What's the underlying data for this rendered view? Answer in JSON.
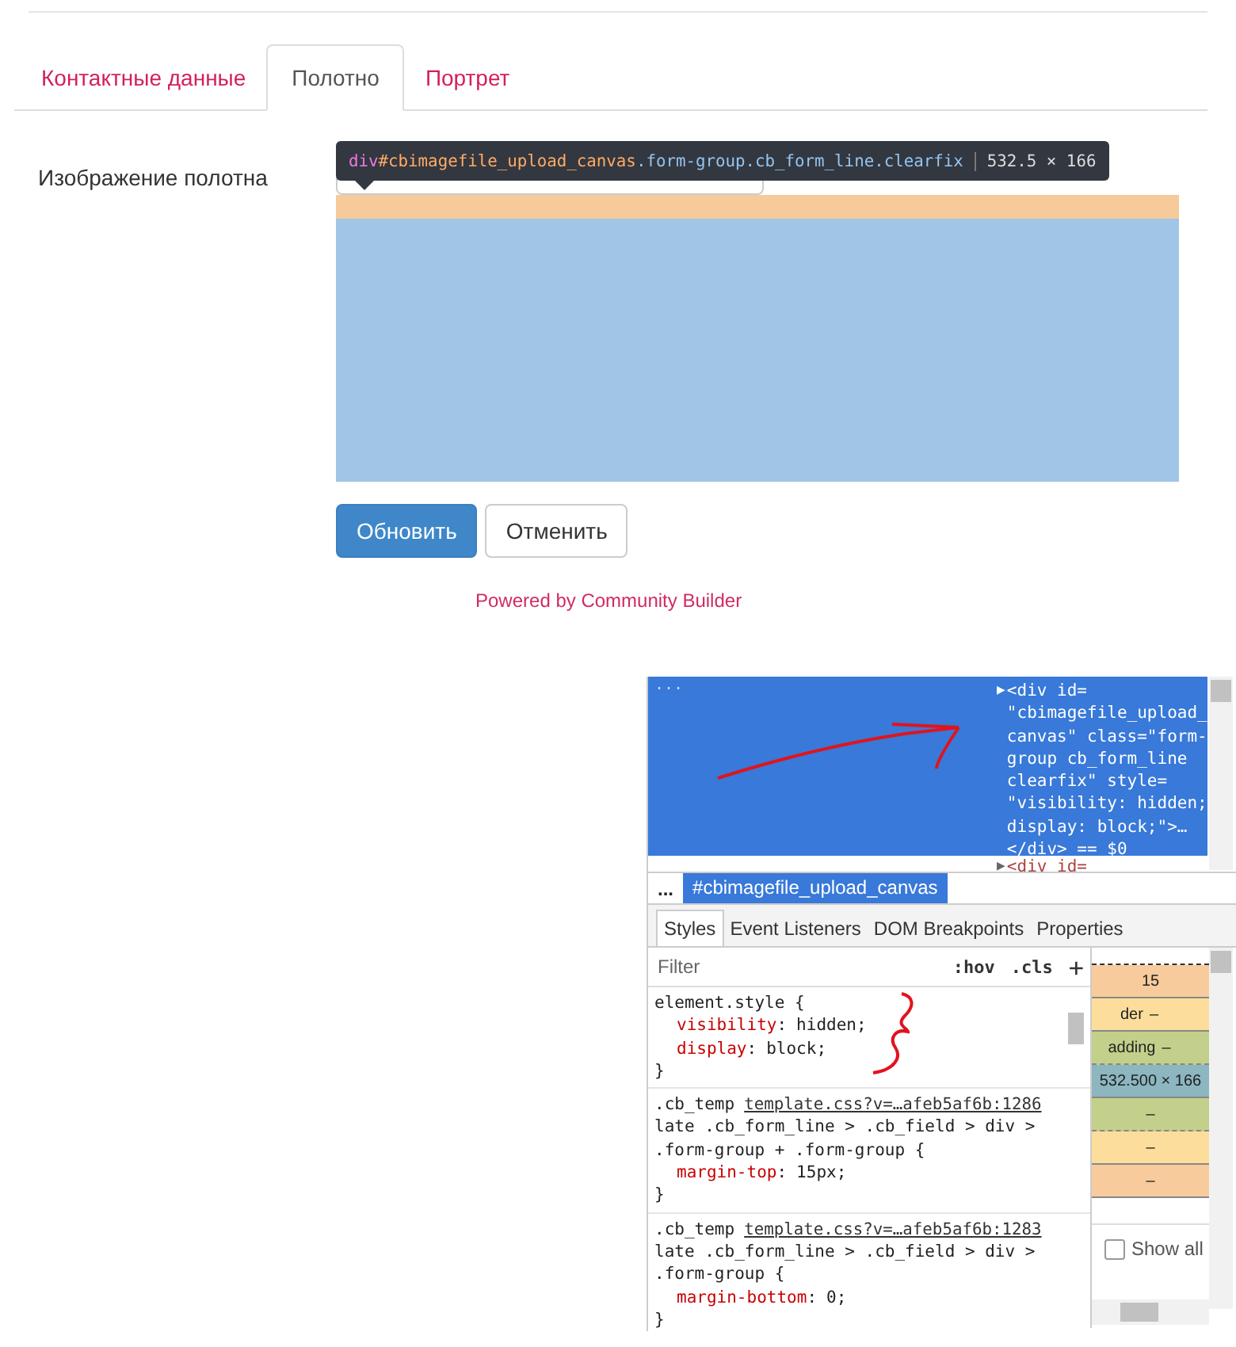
{
  "tabs": [
    {
      "label": "Контактные данные",
      "selected": false
    },
    {
      "label": "Полотно",
      "selected": true
    },
    {
      "label": "Портрет",
      "selected": false
    }
  ],
  "form": {
    "label": "Изображение полотна",
    "tooltip": {
      "tag": "div",
      "id": "#cbimagefile_upload_canvas",
      "classes": ".form-group.cb_form_line.clearfix",
      "size": "532.5 × 166"
    },
    "buttons": [
      {
        "label": "Обновить",
        "kind": "primary"
      },
      {
        "label": "Отменить",
        "kind": "default"
      }
    ],
    "footer_link": "Powered by Community Builder"
  },
  "devtools": {
    "more": "...",
    "dom_node": {
      "toggle": "▶",
      "lines": [
        "<div id=",
        "\"cbimagefile_upload_",
        "canvas\" class=\"form-",
        "group cb_form_line",
        "clearfix\" style=",
        "\"visibility: hidden;",
        "display: block;\">…",
        "</div> == $0"
      ]
    },
    "next_node": {
      "toggle": "▶",
      "text": "<div id="
    },
    "breadcrumb": {
      "more": "...",
      "item": "#cbimagefile_upload_canvas"
    },
    "tabs": [
      {
        "label": "Styles",
        "selected": true
      },
      {
        "label": "Event Listeners",
        "selected": false
      },
      {
        "label": "DOM Breakpoints",
        "selected": false
      },
      {
        "label": "Properties",
        "selected": false
      }
    ],
    "filter": {
      "placeholder": "Filter",
      "hov": ":hov",
      "cls": ".cls",
      "add": "+"
    },
    "rules": [
      {
        "selector": "element.style {",
        "properties": [
          {
            "name": "visibility",
            "sep": ":",
            "value": "hidden;"
          },
          {
            "name": "display",
            "sep": ":",
            "value": "block;"
          }
        ],
        "close": "}"
      },
      {
        "selector_start": ".cb_temp",
        "source": "template.css?v=…afeb5af6b:1286",
        "selector_rest": [
          "late .cb_form_line > .cb_field > div >",
          ".form-group + .form-group {"
        ],
        "properties": [
          {
            "name": "margin-top",
            "sep": ":",
            "value": "15px;"
          }
        ],
        "close": "}"
      },
      {
        "selector_start": ".cb_temp",
        "source": "template.css?v=…afeb5af6b:1283",
        "selector_rest": [
          "late .cb_form_line > .cb_field > div >",
          ".form-group {"
        ],
        "properties": [
          {
            "name": "margin-bottom",
            "sep": ":",
            "value": "0;"
          }
        ],
        "close": "}"
      }
    ],
    "box_model": [
      {
        "kind": "margin",
        "text": "15"
      },
      {
        "kind": "border",
        "label": "der",
        "text": "–"
      },
      {
        "kind": "padding",
        "label": "adding",
        "text": "–"
      },
      {
        "kind": "content",
        "text": "532.500 × 166"
      },
      {
        "kind": "padding",
        "text": "–"
      },
      {
        "kind": "border",
        "text": "–"
      },
      {
        "kind": "margin",
        "text": "–"
      }
    ],
    "show_all": {
      "label": "Show all",
      "checked": false
    }
  }
}
